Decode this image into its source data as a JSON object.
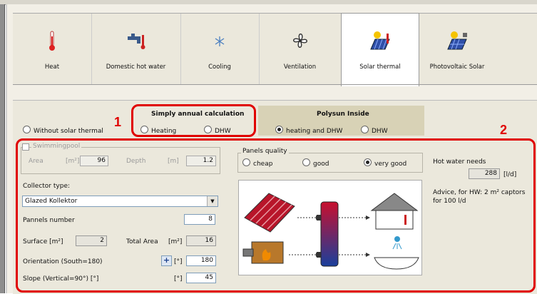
{
  "tabs": [
    {
      "label": "Heat",
      "icon": "thermometer-icon"
    },
    {
      "label": "Domestic hot water",
      "icon": "faucet-icon"
    },
    {
      "label": "Cooling",
      "icon": "snowflake-icon"
    },
    {
      "label": "Ventilation",
      "icon": "fan-icon"
    },
    {
      "label": "Solar thermal",
      "icon": "solar-thermal-icon"
    },
    {
      "label": "Photovoltaic Solar",
      "icon": "photovoltaic-icon"
    }
  ],
  "active_tab": "Solar thermal",
  "modes": {
    "without_solar": "Without solar thermal",
    "simple": {
      "title": "Simply annual calculation",
      "heating": "Heating",
      "dhw": "DHW"
    },
    "polysun": {
      "title": "Polysun Inside",
      "heating_dhw": "heating and DHW",
      "dhw": "DHW"
    }
  },
  "annotations": {
    "one": "1",
    "two": "2"
  },
  "swimmingpool": {
    "title": "Swimmingpool",
    "area_label": "Area",
    "area_unit": "[m²]",
    "area_value": "96",
    "depth_label": "Depth",
    "depth_unit": "[m]",
    "depth_value": "1.2"
  },
  "collector": {
    "label": "Collector type:",
    "value": "Glazed Kollektor"
  },
  "pannels": {
    "label": "Pannels number",
    "value": "8"
  },
  "surface": {
    "label": "Surface [m²]",
    "value": "2",
    "total_label": "Total Area",
    "total_unit": "[m²]",
    "total_value": "16"
  },
  "orientation": {
    "label": "Orientation (South=180)",
    "plus": "+",
    "unit": "[°]",
    "value": "180"
  },
  "slope": {
    "label": "Slope (Vertical=90°) [°]",
    "unit": "[°]",
    "value": "45"
  },
  "panels_quality": {
    "title": "Panels quality",
    "cheap": "cheap",
    "good": "good",
    "very_good": "very good"
  },
  "hot_water": {
    "label": "Hot water needs",
    "value": "288",
    "unit": "[l/d]",
    "advice": "Advice, for HW: 2 m² captors for 100 l/d"
  },
  "colors": {
    "annotation_red": "#e00000",
    "accent_blue": "#1a3f8c"
  }
}
